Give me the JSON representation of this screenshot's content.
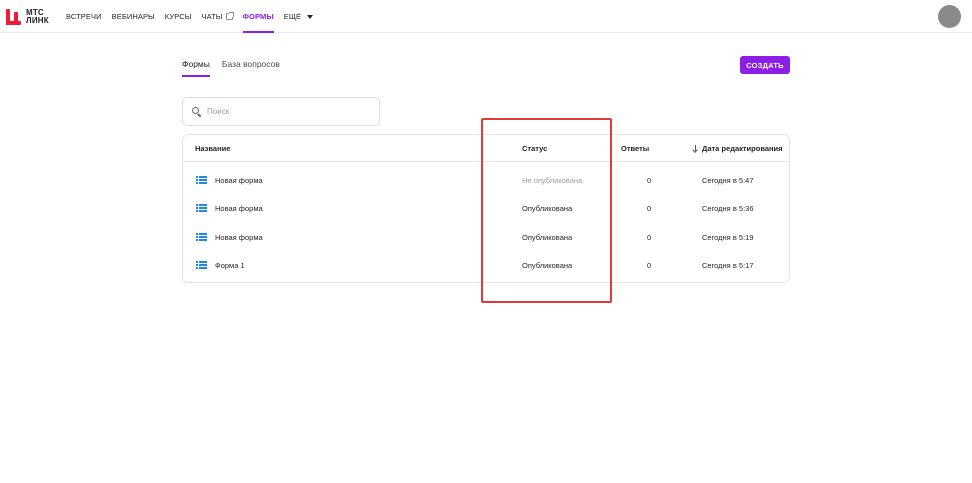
{
  "brand": {
    "logo_text_line1": "МТС",
    "logo_text_line2": "ЛИНК",
    "color": "#ef1c33"
  },
  "accent_color": "#8c1ee6",
  "nav": {
    "items": [
      {
        "label": "ВСТРЕЧИ"
      },
      {
        "label": "ВЕБИНАРЫ"
      },
      {
        "label": "КУРСЫ"
      },
      {
        "label": "ЧАТЫ"
      },
      {
        "label": "ФОРМЫ",
        "active": true
      },
      {
        "label": "ЕЩЁ"
      }
    ]
  },
  "subtabs": [
    {
      "label": "Формы",
      "active": true
    },
    {
      "label": "База вопросов"
    }
  ],
  "create_button": "СОЗДАТЬ",
  "search": {
    "placeholder": "Поиск"
  },
  "table": {
    "columns": {
      "name": "Название",
      "status": "Статус",
      "answers": "Ответы",
      "edited": "Дата редактирования"
    },
    "sort_column": "edited",
    "rows": [
      {
        "name": "Новая форма",
        "status": "Не опубликована",
        "answers": "0",
        "edited": "Сегодня в 5:47",
        "published": false
      },
      {
        "name": "Новая форма",
        "status": "Опубликована",
        "answers": "0",
        "edited": "Сегодня в 5:36",
        "published": true
      },
      {
        "name": "Новая форма",
        "status": "Опубликована",
        "answers": "0",
        "edited": "Сегодня в 5:19",
        "published": true
      },
      {
        "name": "Форма 1",
        "status": "Опубликована",
        "answers": "0",
        "edited": "Сегодня в 5:17",
        "published": true
      }
    ]
  },
  "annotation": {
    "color": "#e23a3a"
  }
}
